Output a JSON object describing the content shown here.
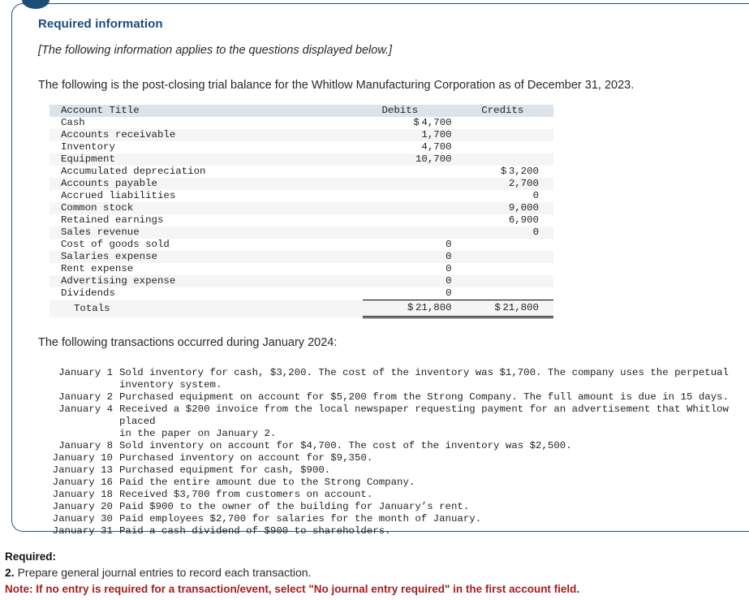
{
  "card": {
    "heading": "Required information",
    "applies_note": "[The following information applies to the questions displayed below.]",
    "intro": "The following is the post-closing trial balance for the Whitlow Manufacturing Corporation as of December 31, 2023.",
    "transactions_intro": "The following transactions occurred during January 2024:"
  },
  "trial_balance": {
    "columns": [
      "Account Title",
      "Debits",
      "Credits"
    ],
    "rows": [
      {
        "title": "Cash",
        "debit_sym": "$",
        "debit": "4,700",
        "credit_sym": "",
        "credit": ""
      },
      {
        "title": "Accounts receivable",
        "debit_sym": "",
        "debit": "1,700",
        "credit_sym": "",
        "credit": ""
      },
      {
        "title": "Inventory",
        "debit_sym": "",
        "debit": "4,700",
        "credit_sym": "",
        "credit": ""
      },
      {
        "title": "Equipment",
        "debit_sym": "",
        "debit": "10,700",
        "credit_sym": "",
        "credit": ""
      },
      {
        "title": "Accumulated depreciation",
        "debit_sym": "",
        "debit": "",
        "credit_sym": "$",
        "credit": "3,200"
      },
      {
        "title": "Accounts payable",
        "debit_sym": "",
        "debit": "",
        "credit_sym": "",
        "credit": "2,700"
      },
      {
        "title": "Accrued liabilities",
        "debit_sym": "",
        "debit": "",
        "credit_sym": "",
        "credit": "0"
      },
      {
        "title": "Common stock",
        "debit_sym": "",
        "debit": "",
        "credit_sym": "",
        "credit": "9,000"
      },
      {
        "title": "Retained earnings",
        "debit_sym": "",
        "debit": "",
        "credit_sym": "",
        "credit": "6,900"
      },
      {
        "title": "Sales revenue",
        "debit_sym": "",
        "debit": "",
        "credit_sym": "",
        "credit": "0"
      },
      {
        "title": "Cost of goods sold",
        "debit_sym": "",
        "debit": "0",
        "credit_sym": "",
        "credit": ""
      },
      {
        "title": "Salaries expense",
        "debit_sym": "",
        "debit": "0",
        "credit_sym": "",
        "credit": ""
      },
      {
        "title": "Rent expense",
        "debit_sym": "",
        "debit": "0",
        "credit_sym": "",
        "credit": ""
      },
      {
        "title": "Advertising expense",
        "debit_sym": "",
        "debit": "0",
        "credit_sym": "",
        "credit": ""
      },
      {
        "title": "Dividends",
        "debit_sym": "",
        "debit": "0",
        "credit_sym": "",
        "credit": ""
      }
    ],
    "totals": {
      "title": "Totals",
      "debit_sym": "$",
      "debit": "21,800",
      "credit_sym": "$",
      "credit": "21,800"
    }
  },
  "transactions": [
    {
      "date": "January 1",
      "desc": "Sold inventory for cash, $3,200. The cost of the inventory was $1,700. The company uses the perpetual\ninventory system."
    },
    {
      "date": "January 2",
      "desc": "Purchased equipment on account for $5,200 from the Strong Company. The full amount is due in 15 days."
    },
    {
      "date": "January 4",
      "desc": "Received a $200 invoice from the local newspaper requesting payment for an advertisement that Whitlow placed\nin the paper on January 2."
    },
    {
      "date": "January 8",
      "desc": "Sold inventory on account for $4,700. The cost of the inventory was $2,500."
    },
    {
      "date": "January 10",
      "desc": "Purchased inventory on account for $9,350."
    },
    {
      "date": "January 13",
      "desc": "Purchased equipment for cash, $900."
    },
    {
      "date": "January 16",
      "desc": "Paid the entire amount due to the Strong Company."
    },
    {
      "date": "January 18",
      "desc": "Received $3,700 from customers on account."
    },
    {
      "date": "January 20",
      "desc": "Paid $900 to the owner of the building for January’s rent."
    },
    {
      "date": "January 30",
      "desc": "Paid employees $2,700 for salaries for the month of January."
    },
    {
      "date": "January 31",
      "desc": "Paid a cash dividend of $900 to shareholders."
    }
  ],
  "footer": {
    "required_label": "Required:",
    "item_number": "2.",
    "item_text": " Prepare general journal entries to record each transaction.",
    "note": "Note: If no entry is required for a transaction/event, select \"No journal entry required\" in the first account field."
  },
  "colors": {
    "heading_blue": "#1b4a80",
    "card_border": "#1f5582",
    "badge": "#1d4e79",
    "table_header_bg": "#dde3ea",
    "row_alt_bg": "#f4f5f6",
    "note_red": "#a51c1c"
  }
}
